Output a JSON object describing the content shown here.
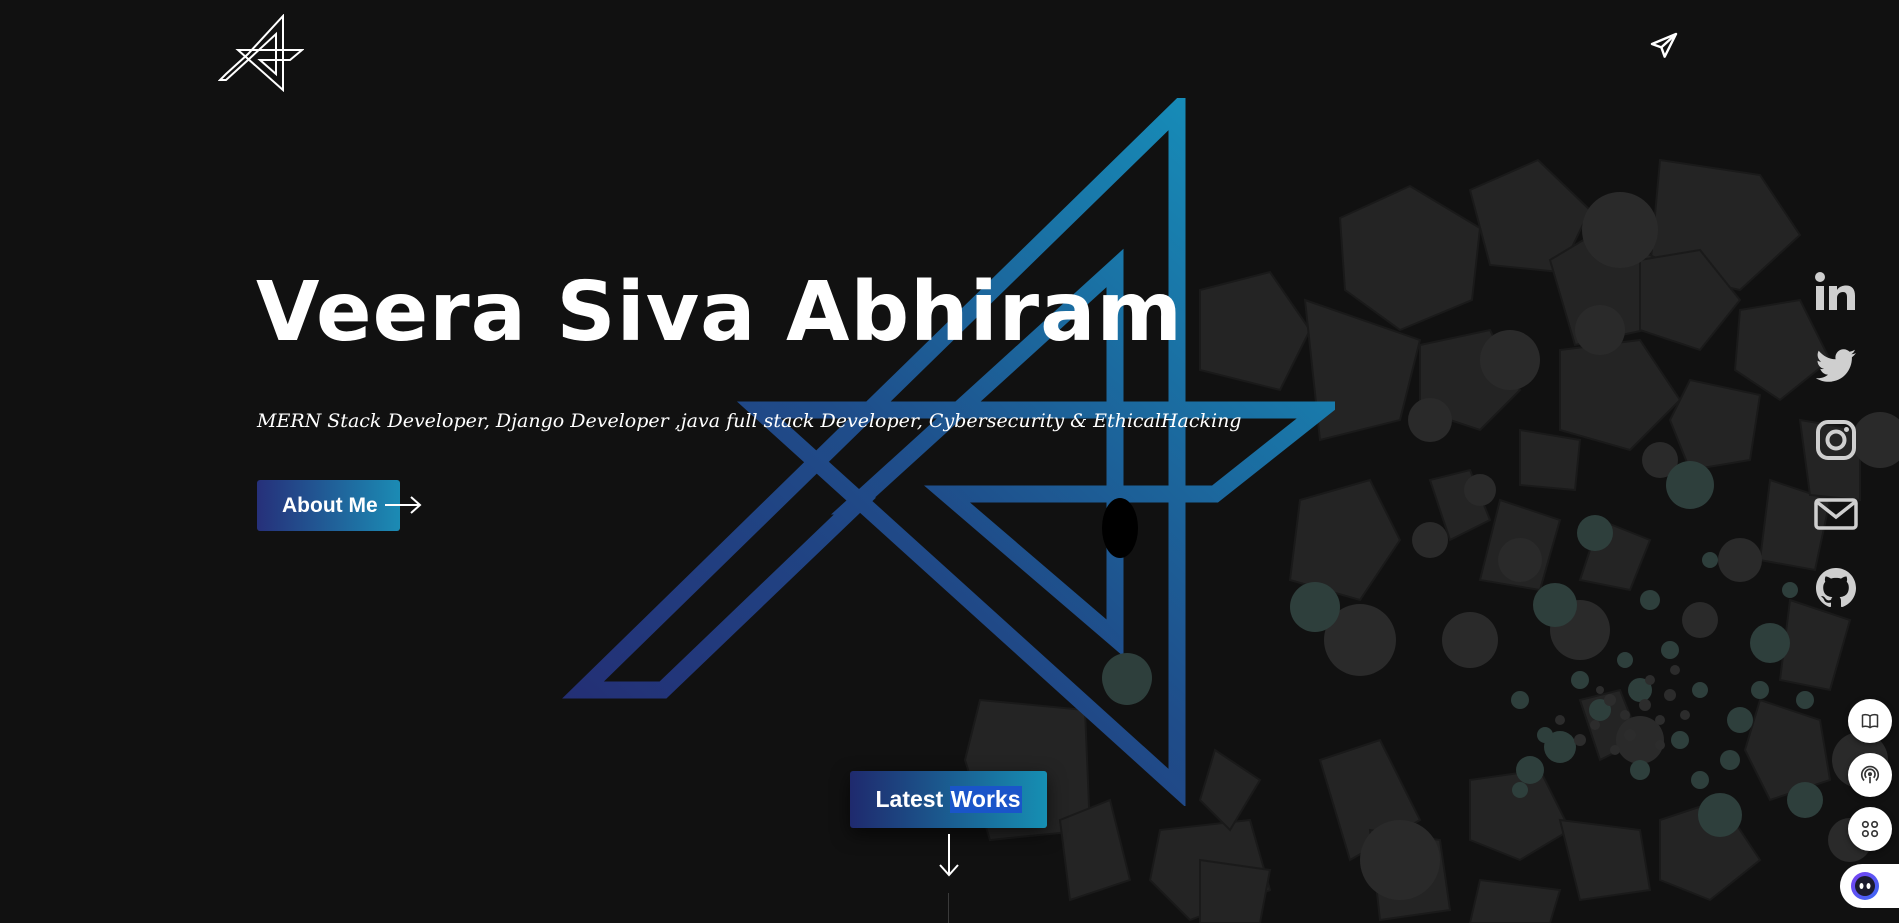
{
  "hero": {
    "name": "Veera Siva Abhiram",
    "tagline_plain": "MERN Stack Developer, Django Developer ,java full stack Developer, Cybersecurity & EthicalHacking",
    "tagline": "MERN Stack Developer, Django Developer ,java full stack Developer, Cybersecurity & EthicalHacking"
  },
  "buttons": {
    "about_label": "About Me",
    "latest_prefix": "Latest ",
    "latest_highlight": "Works"
  },
  "icons": {
    "logo": "logo-icon",
    "send": "paper-plane-icon",
    "social": [
      "linkedin-icon",
      "twitter-icon",
      "instagram-icon",
      "mail-icon",
      "github-icon"
    ],
    "tools": [
      "book-icon",
      "podcast-icon",
      "apps-icon",
      "assistant-icon"
    ],
    "scroll": "arrow-down-icon"
  },
  "colors": {
    "background": "#111111",
    "gradient_start": "#26307a",
    "gradient_end": "#1b8bb4",
    "shapes": "#262626",
    "bubbles": "#2e3f3c",
    "social_icons": "#cfcfcf"
  }
}
